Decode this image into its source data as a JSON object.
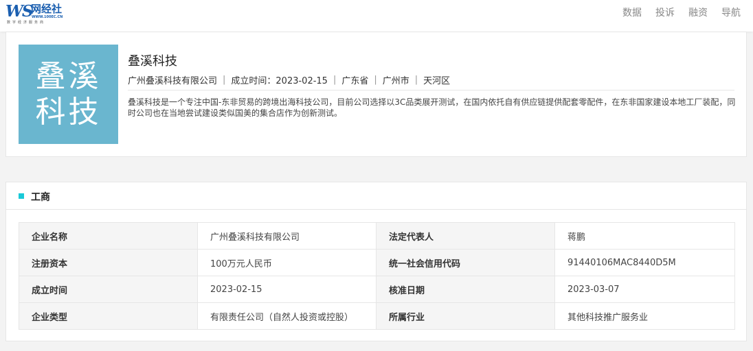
{
  "header": {
    "logo": {
      "mark": "WS",
      "name": "网经社",
      "url": "WWW.100EC.CN",
      "slogan": "数字经济服务商"
    },
    "nav": [
      "数据",
      "投诉",
      "融资",
      "导航"
    ]
  },
  "company": {
    "logo_text": [
      "叠溪",
      "科技"
    ],
    "name": "叠溪科技",
    "full_name": "广州叠溪科技有限公司",
    "founded_label": "成立时间：2023-02-15",
    "province": "广东省",
    "city": "广州市",
    "district": "天河区",
    "separator": "|",
    "description": "叠溪科技是一个专注中国-东非贸易的跨境出海科技公司，目前公司选择以3C品类展开测试，在国内依托自有供应链提供配套零配件，在东非国家建设本地工厂装配，同时公司也在当地尝试建设类似国美的集合店作为创新测试。"
  },
  "business": {
    "section_title": "工商",
    "rows": [
      {
        "label1": "企业名称",
        "value1": "广州叠溪科技有限公司",
        "label2": "法定代表人",
        "value2": "蒋鹏"
      },
      {
        "label1": "注册资本",
        "value1": "100万元人民币",
        "label2": "统一社会信用代码",
        "value2": "91440106MAC8440D5M"
      },
      {
        "label1": "成立时间",
        "value1": "2023-02-15",
        "label2": "核准日期",
        "value2": "2023-03-07"
      },
      {
        "label1": "企业类型",
        "value1": "有限责任公司（自然人投资或控股）",
        "label2": "所属行业",
        "value2": "其他科技推广服务业"
      }
    ]
  },
  "colors": {
    "brand": "#1b5fb0",
    "logo_bg": "#6ab6cf",
    "section_mark": "#19c9d8"
  }
}
